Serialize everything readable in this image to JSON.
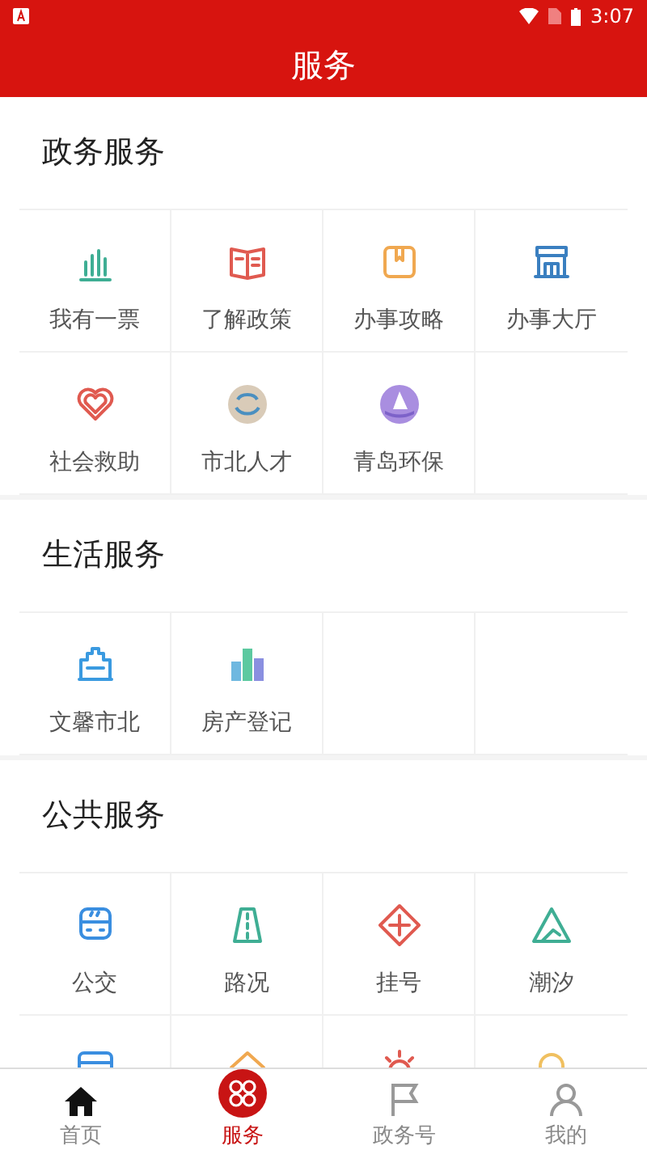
{
  "status_bar": {
    "time": "3:07"
  },
  "header": {
    "title": "服务"
  },
  "sections": [
    {
      "title": "政务服务",
      "items": [
        {
          "kind": "bars",
          "label": "我有一票"
        },
        {
          "kind": "book",
          "label": "了解政策"
        },
        {
          "kind": "bookmark",
          "label": "办事攻略"
        },
        {
          "kind": "store",
          "label": "办事大厅"
        },
        {
          "kind": "heart",
          "label": "社会救助"
        },
        {
          "kind": "avatar",
          "label": "市北人才"
        },
        {
          "kind": "sail",
          "label": "青岛环保"
        }
      ]
    },
    {
      "title": "生活服务",
      "items": [
        {
          "kind": "building",
          "label": "文馨市北"
        },
        {
          "kind": "towers",
          "label": "房产登记"
        }
      ]
    },
    {
      "title": "公共服务",
      "items": [
        {
          "kind": "bus",
          "label": "公交"
        },
        {
          "kind": "road",
          "label": "路况"
        },
        {
          "kind": "cross",
          "label": "挂号"
        },
        {
          "kind": "mountain",
          "label": "潮汐"
        },
        {
          "kind": "card"
        },
        {
          "kind": "house"
        },
        {
          "kind": "sun"
        },
        {
          "kind": "bell"
        }
      ]
    }
  ],
  "nav": [
    {
      "kind": "home",
      "label": "首页",
      "selected": false
    },
    {
      "kind": "grid",
      "label": "服务",
      "selected": true
    },
    {
      "kind": "flag",
      "label": "政务号",
      "selected": false
    },
    {
      "kind": "person",
      "label": "我的",
      "selected": false
    }
  ]
}
